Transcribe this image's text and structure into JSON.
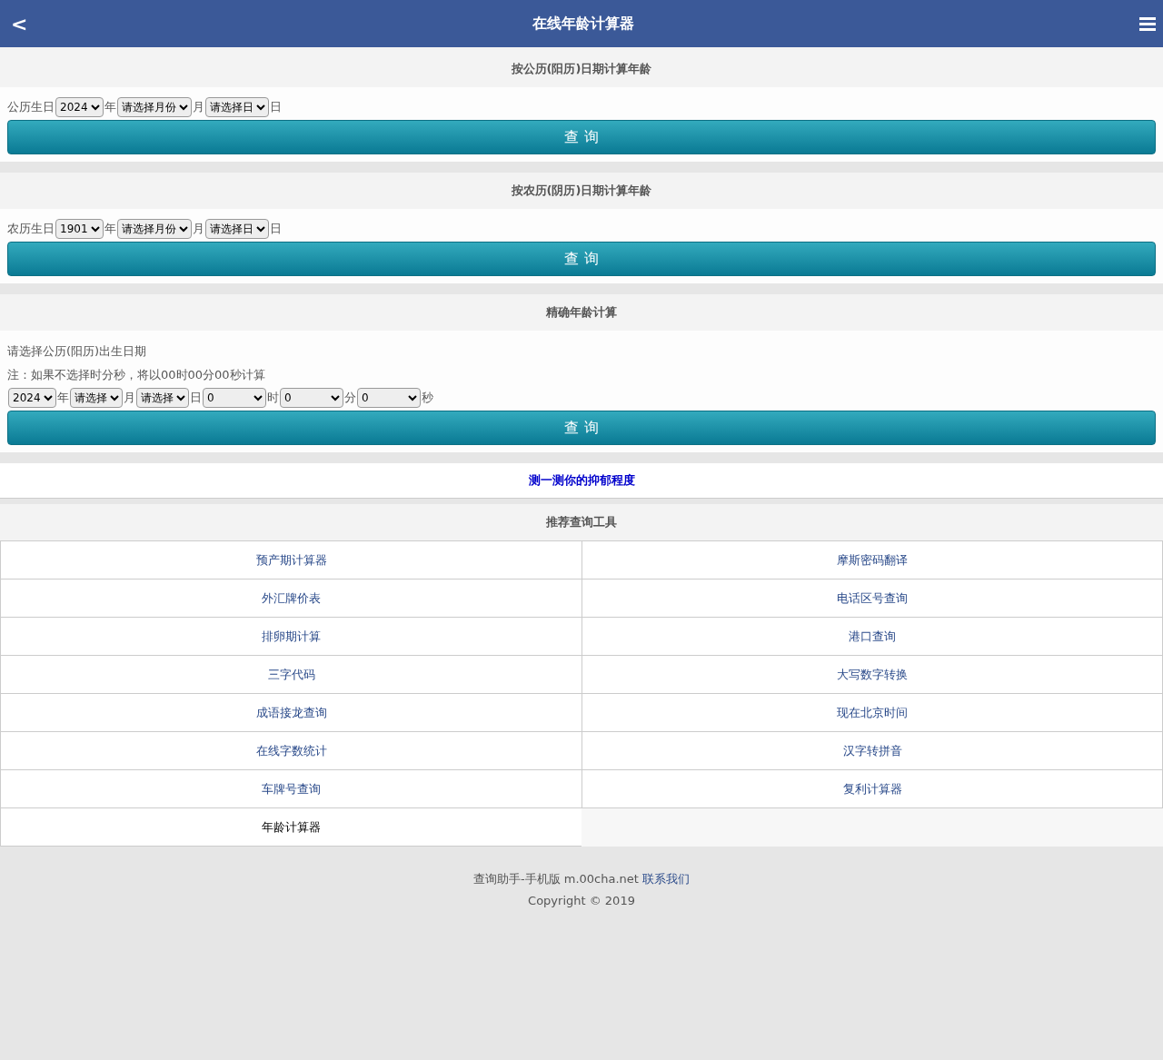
{
  "header": {
    "back": "<",
    "title": "在线年龄计算器"
  },
  "sections": [
    {
      "title": "按公历(阳历)日期计算年龄",
      "row": [
        {
          "kind": "text",
          "text": "公历生日"
        },
        {
          "kind": "select",
          "value": "2024"
        },
        {
          "kind": "text",
          "text": "年"
        },
        {
          "kind": "select",
          "value": "请选择月份"
        },
        {
          "kind": "text",
          "text": "月"
        },
        {
          "kind": "select",
          "value": "请选择日"
        },
        {
          "kind": "text",
          "text": "日"
        }
      ],
      "button": "查 询"
    },
    {
      "title": "按农历(阴历)日期计算年龄",
      "row": [
        {
          "kind": "text",
          "text": "农历生日"
        },
        {
          "kind": "select",
          "value": "1901"
        },
        {
          "kind": "text",
          "text": "年"
        },
        {
          "kind": "select",
          "value": "请选择月份"
        },
        {
          "kind": "text",
          "text": "月"
        },
        {
          "kind": "select",
          "value": "请选择日"
        },
        {
          "kind": "text",
          "text": "日"
        }
      ],
      "button": "查 询"
    },
    {
      "title": "精确年龄计算",
      "notes": [
        "请选择公历(阳历)出生日期",
        "注：如果不选择时分秒，将以00时00分00秒计算"
      ],
      "row": [
        {
          "kind": "select",
          "value": "2024"
        },
        {
          "kind": "text",
          "text": "年"
        },
        {
          "kind": "select",
          "value": "请选择"
        },
        {
          "kind": "text",
          "text": "月"
        },
        {
          "kind": "select",
          "value": "请选择"
        },
        {
          "kind": "text",
          "text": "日"
        },
        {
          "kind": "time",
          "value": "0"
        },
        {
          "kind": "text",
          "text": "时"
        },
        {
          "kind": "time",
          "value": "0"
        },
        {
          "kind": "text",
          "text": "分"
        },
        {
          "kind": "time",
          "value": "0"
        },
        {
          "kind": "text",
          "text": "秒"
        }
      ],
      "button": "查 询"
    }
  ],
  "promo_link": "测一测你的抑郁程度",
  "tools": {
    "title": "推荐查询工具",
    "items": [
      {
        "label": "预产期计算器",
        "selected": false
      },
      {
        "label": "摩斯密码翻译",
        "selected": false
      },
      {
        "label": "外汇牌价表",
        "selected": false
      },
      {
        "label": "电话区号查询",
        "selected": false
      },
      {
        "label": "排卵期计算",
        "selected": false
      },
      {
        "label": "港口查询",
        "selected": false
      },
      {
        "label": "三字代码",
        "selected": false
      },
      {
        "label": "大写数字转换",
        "selected": false
      },
      {
        "label": "成语接龙查询",
        "selected": false
      },
      {
        "label": "现在北京时间",
        "selected": false
      },
      {
        "label": "在线字数统计",
        "selected": false
      },
      {
        "label": "汉字转拼音",
        "selected": false
      },
      {
        "label": "车牌号查询",
        "selected": false
      },
      {
        "label": "复利计算器",
        "selected": false
      },
      {
        "label": "年龄计算器",
        "selected": true
      }
    ]
  },
  "footer": {
    "text": "查询助手-手机版 m.00cha.net",
    "link": "联系我们",
    "copyright": "Copyright © 2019"
  }
}
